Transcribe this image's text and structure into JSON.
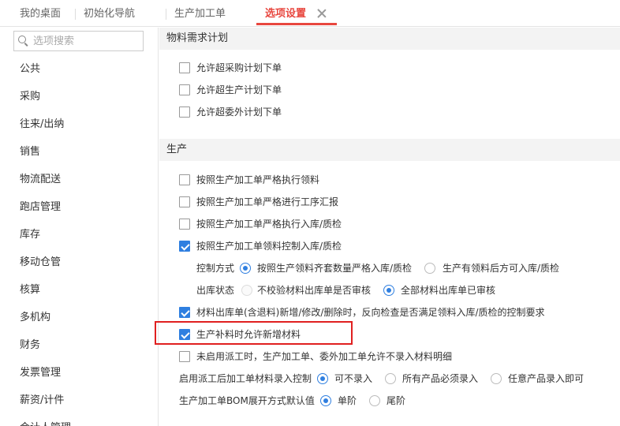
{
  "tabs": [
    {
      "label": "我的桌面",
      "active": false
    },
    {
      "label": "初始化导航",
      "active": false
    },
    {
      "label": "生产加工单",
      "active": false
    },
    {
      "label": "选项设置",
      "active": true
    }
  ],
  "search": {
    "placeholder": "选项搜索",
    "value": ""
  },
  "sidebar": {
    "items": [
      "公共",
      "采购",
      "往来/出纳",
      "销售",
      "物流配送",
      "跑店管理",
      "库存",
      "移动仓管",
      "核算",
      "多机构",
      "财务",
      "发票管理",
      "薪资/计件",
      "会计人管理"
    ]
  },
  "sections": {
    "material_plan": {
      "title": "物料需求计划",
      "options": [
        {
          "label": "允许超采购计划下单",
          "checked": false
        },
        {
          "label": "允许超生产计划下单",
          "checked": false
        },
        {
          "label": "允许超委外计划下单",
          "checked": false
        }
      ]
    },
    "production": {
      "title": "生产",
      "options": [
        {
          "label": "按照生产加工单严格执行领料",
          "checked": false
        },
        {
          "label": "按照生产加工单严格进行工序汇报",
          "checked": false
        },
        {
          "label": "按照生产加工单严格执行入库/质检",
          "checked": false
        },
        {
          "label": "按照生产加工单领料控制入库/质检",
          "checked": true
        }
      ],
      "control_mode": {
        "label": "控制方式",
        "options": [
          {
            "label": "按照生产领料齐套数量严格入库/质检",
            "selected": true
          },
          {
            "label": "生产有领料后方可入库/质检",
            "selected": false
          }
        ]
      },
      "outbound_status": {
        "label": "出库状态",
        "options": [
          {
            "label": "不校验材料出库单是否审核",
            "selected": false,
            "disabled": true
          },
          {
            "label": "全部材料出库单已审核",
            "selected": true
          }
        ]
      },
      "options2": [
        {
          "label": "材料出库单(含退料)新增/修改/删除时，反向检查是否满足领料入库/质检的控制要求",
          "checked": true
        },
        {
          "label": "生产补料时允许新增材料",
          "checked": true
        },
        {
          "label": "未启用派工时，生产加工单、委外加工单允许不录入材料明细",
          "checked": false
        }
      ],
      "dispatch_entry": {
        "label": "启用派工后加工单材料录入控制",
        "options": [
          {
            "label": "可不录入",
            "selected": true
          },
          {
            "label": "所有产品必须录入",
            "selected": false
          },
          {
            "label": "任意产品录入即可",
            "selected": false
          }
        ]
      },
      "bom_expand": {
        "label": "生产加工单BOM展开方式默认值",
        "options": [
          {
            "label": "单阶",
            "selected": true
          },
          {
            "label": "尾阶",
            "selected": false
          }
        ]
      }
    }
  },
  "colors": {
    "accent": "#e8473f",
    "checkbox": "#2f7fe0",
    "highlight": "#e02020"
  }
}
